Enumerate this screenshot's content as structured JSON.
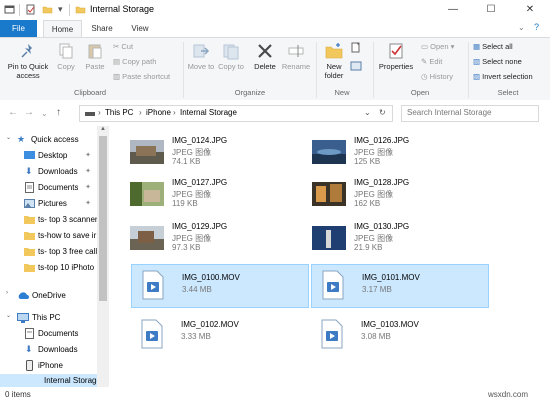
{
  "window": {
    "title": "Internal Storage",
    "minimize": "—",
    "maximize": "☐",
    "close": "✕"
  },
  "tabs": {
    "file": "File",
    "home": "Home",
    "share": "Share",
    "view": "View"
  },
  "ribbon": {
    "clipboard": {
      "pin": "Pin to Quick access",
      "copy": "Copy",
      "paste": "Paste",
      "cut": "Cut",
      "copy_path": "Copy path",
      "paste_shortcut": "Paste shortcut",
      "label": "Clipboard"
    },
    "organize": {
      "move_to": "Move to",
      "copy_to": "Copy to",
      "delete": "Delete",
      "rename": "Rename",
      "label": "Organize"
    },
    "new": {
      "new_folder": "New folder",
      "label": "New"
    },
    "open": {
      "properties": "Properties",
      "open": "Open",
      "edit": "Edit",
      "history": "History",
      "label": "Open"
    },
    "select": {
      "select_all": "Select all",
      "select_none": "Select none",
      "invert": "Invert selection",
      "label": "Select"
    }
  },
  "address": {
    "crumbs": [
      "This PC",
      "iPhone",
      "Internal Storage"
    ],
    "search_placeholder": "Search Internal Storage"
  },
  "nav": {
    "quick_access": "Quick access",
    "items": [
      "Desktop",
      "Downloads",
      "Documents",
      "Pictures",
      "ts- top 3 scanner",
      "ts-how to save ir",
      "ts- top 3 free call",
      "ts-top 10 iPhoto"
    ],
    "onedrive": "OneDrive",
    "this_pc": "This PC",
    "pc_items": [
      "Documents",
      "Downloads",
      "iPhone",
      "Internal Storage"
    ]
  },
  "files": [
    {
      "name": "IMG_0124.JPG",
      "type": "JPEG 图像",
      "size": "74.1 KB"
    },
    {
      "name": "IMG_0126.JPG",
      "type": "JPEG 图像",
      "size": "125 KB"
    },
    {
      "name": "IMG_0127.JPG",
      "type": "JPEG 图像",
      "size": "119 KB"
    },
    {
      "name": "IMG_0128.JPG",
      "type": "JPEG 图像",
      "size": "162 KB"
    },
    {
      "name": "IMG_0129.JPG",
      "type": "JPEG 图像",
      "size": "97.3 KB"
    },
    {
      "name": "IMG_0130.JPG",
      "type": "JPEG 图像",
      "size": "21.9 KB"
    },
    {
      "name": "IMG_0100.MOV",
      "type": "",
      "size": "3.44 MB"
    },
    {
      "name": "IMG_0101.MOV",
      "type": "",
      "size": "3.17 MB"
    },
    {
      "name": "IMG_0102.MOV",
      "type": "",
      "size": "3.33 MB"
    },
    {
      "name": "IMG_0103.MOV",
      "type": "",
      "size": "3.08 MB"
    }
  ],
  "status": {
    "items": "0 items"
  },
  "watermark": "wsxdn.com"
}
